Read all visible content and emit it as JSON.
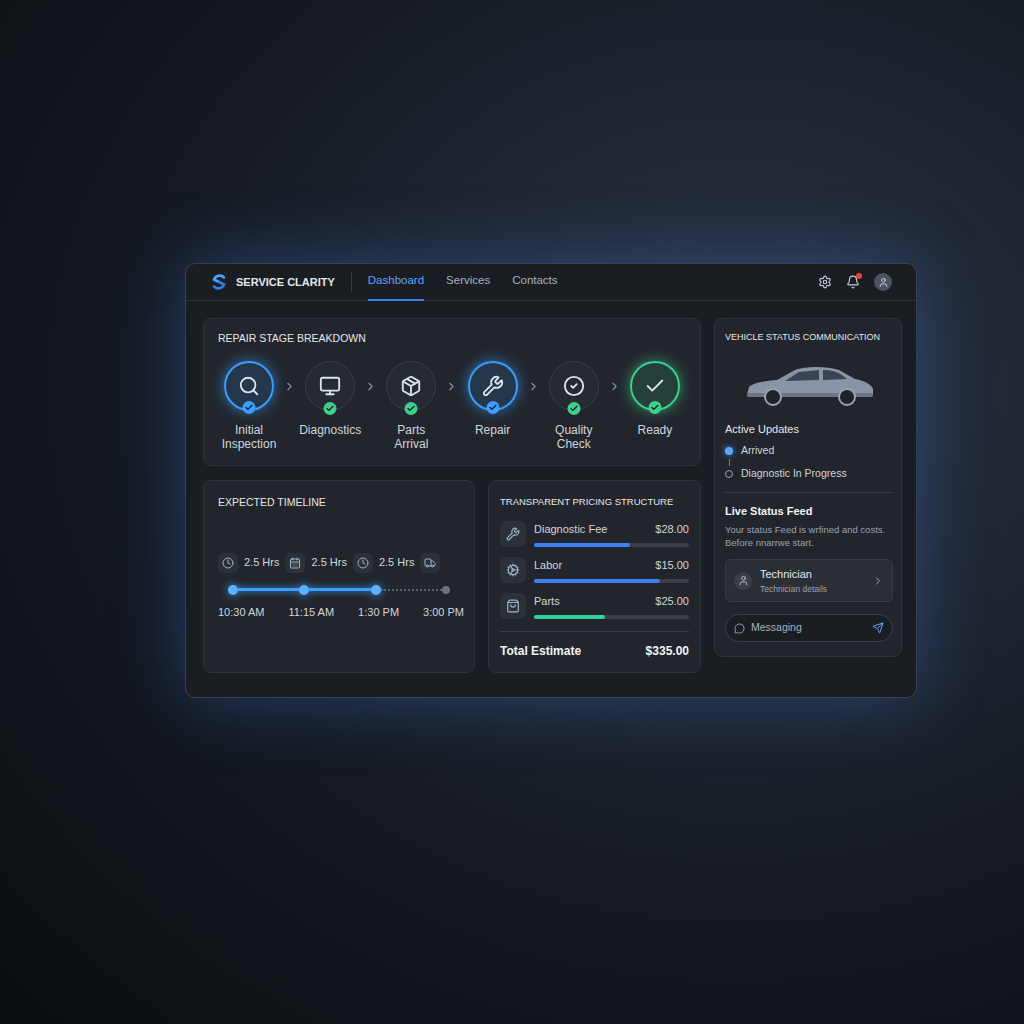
{
  "header": {
    "brand": "SERVICE CLARITY",
    "nav": [
      {
        "label": "Dashboard",
        "selected": true
      },
      {
        "label": "Services",
        "selected": false
      },
      {
        "label": "Contacts",
        "selected": false
      }
    ],
    "notifications": true
  },
  "stages": {
    "title": "REPAIR STAGE BREAKDOWN",
    "items": [
      {
        "label": "Initial Inspection",
        "highlighted": true,
        "color": "#3b9eff"
      },
      {
        "label": "Diagnostics",
        "highlighted": false,
        "color": "#3ecf8e"
      },
      {
        "label": "Parts Arrival",
        "highlighted": false,
        "color": "#3ecf8e"
      },
      {
        "label": "Repair",
        "highlighted": true,
        "color": "#3b9eff"
      },
      {
        "label": "Quality Check",
        "highlighted": false,
        "color": "#3ecf8e"
      },
      {
        "label": "Ready",
        "highlighted": true,
        "color": "#3ecf8e"
      }
    ]
  },
  "timeline": {
    "title": "EXPECTED TIMELINE",
    "durations": [
      "2.5 Hrs",
      "2.5 Hrs",
      "2.5 Hrs"
    ],
    "points": [
      {
        "time": "10:30 AM",
        "reached": true
      },
      {
        "time": "11:15 AM",
        "reached": true
      },
      {
        "time": "1:30 PM",
        "reached": true
      },
      {
        "time": "3:00 PM",
        "reached": false
      }
    ]
  },
  "pricing": {
    "title": "TRANSPARENT PRICING STRUCTURE",
    "items": [
      {
        "label": "Diagnostic Fee",
        "amount": "$28.00",
        "level": 0.62,
        "color": "#3b82f6"
      },
      {
        "label": "Labor",
        "amount": "$15.00",
        "level": 0.81,
        "color": "#3b82f6"
      },
      {
        "label": "Parts",
        "amount": "$25.00",
        "level": 0.46,
        "color": "#34d399"
      }
    ],
    "total_label": "Total Estimate",
    "total": "$335.00"
  },
  "vehicle": {
    "title": "VEHICLE STATUS COMMUNICATION",
    "updates_title": "Active Updates",
    "updates": [
      {
        "label": "Arrived",
        "active": true
      },
      {
        "label": "Diagnostic In Progress",
        "active": false
      }
    ],
    "feed_title": "Live Status Feed",
    "feed_text": "Your status Feed is wrfined and costs. Before nnarrwe start.",
    "technician": {
      "name": "Technician",
      "detail": "Technician details"
    },
    "message_placeholder": "Messaging"
  }
}
